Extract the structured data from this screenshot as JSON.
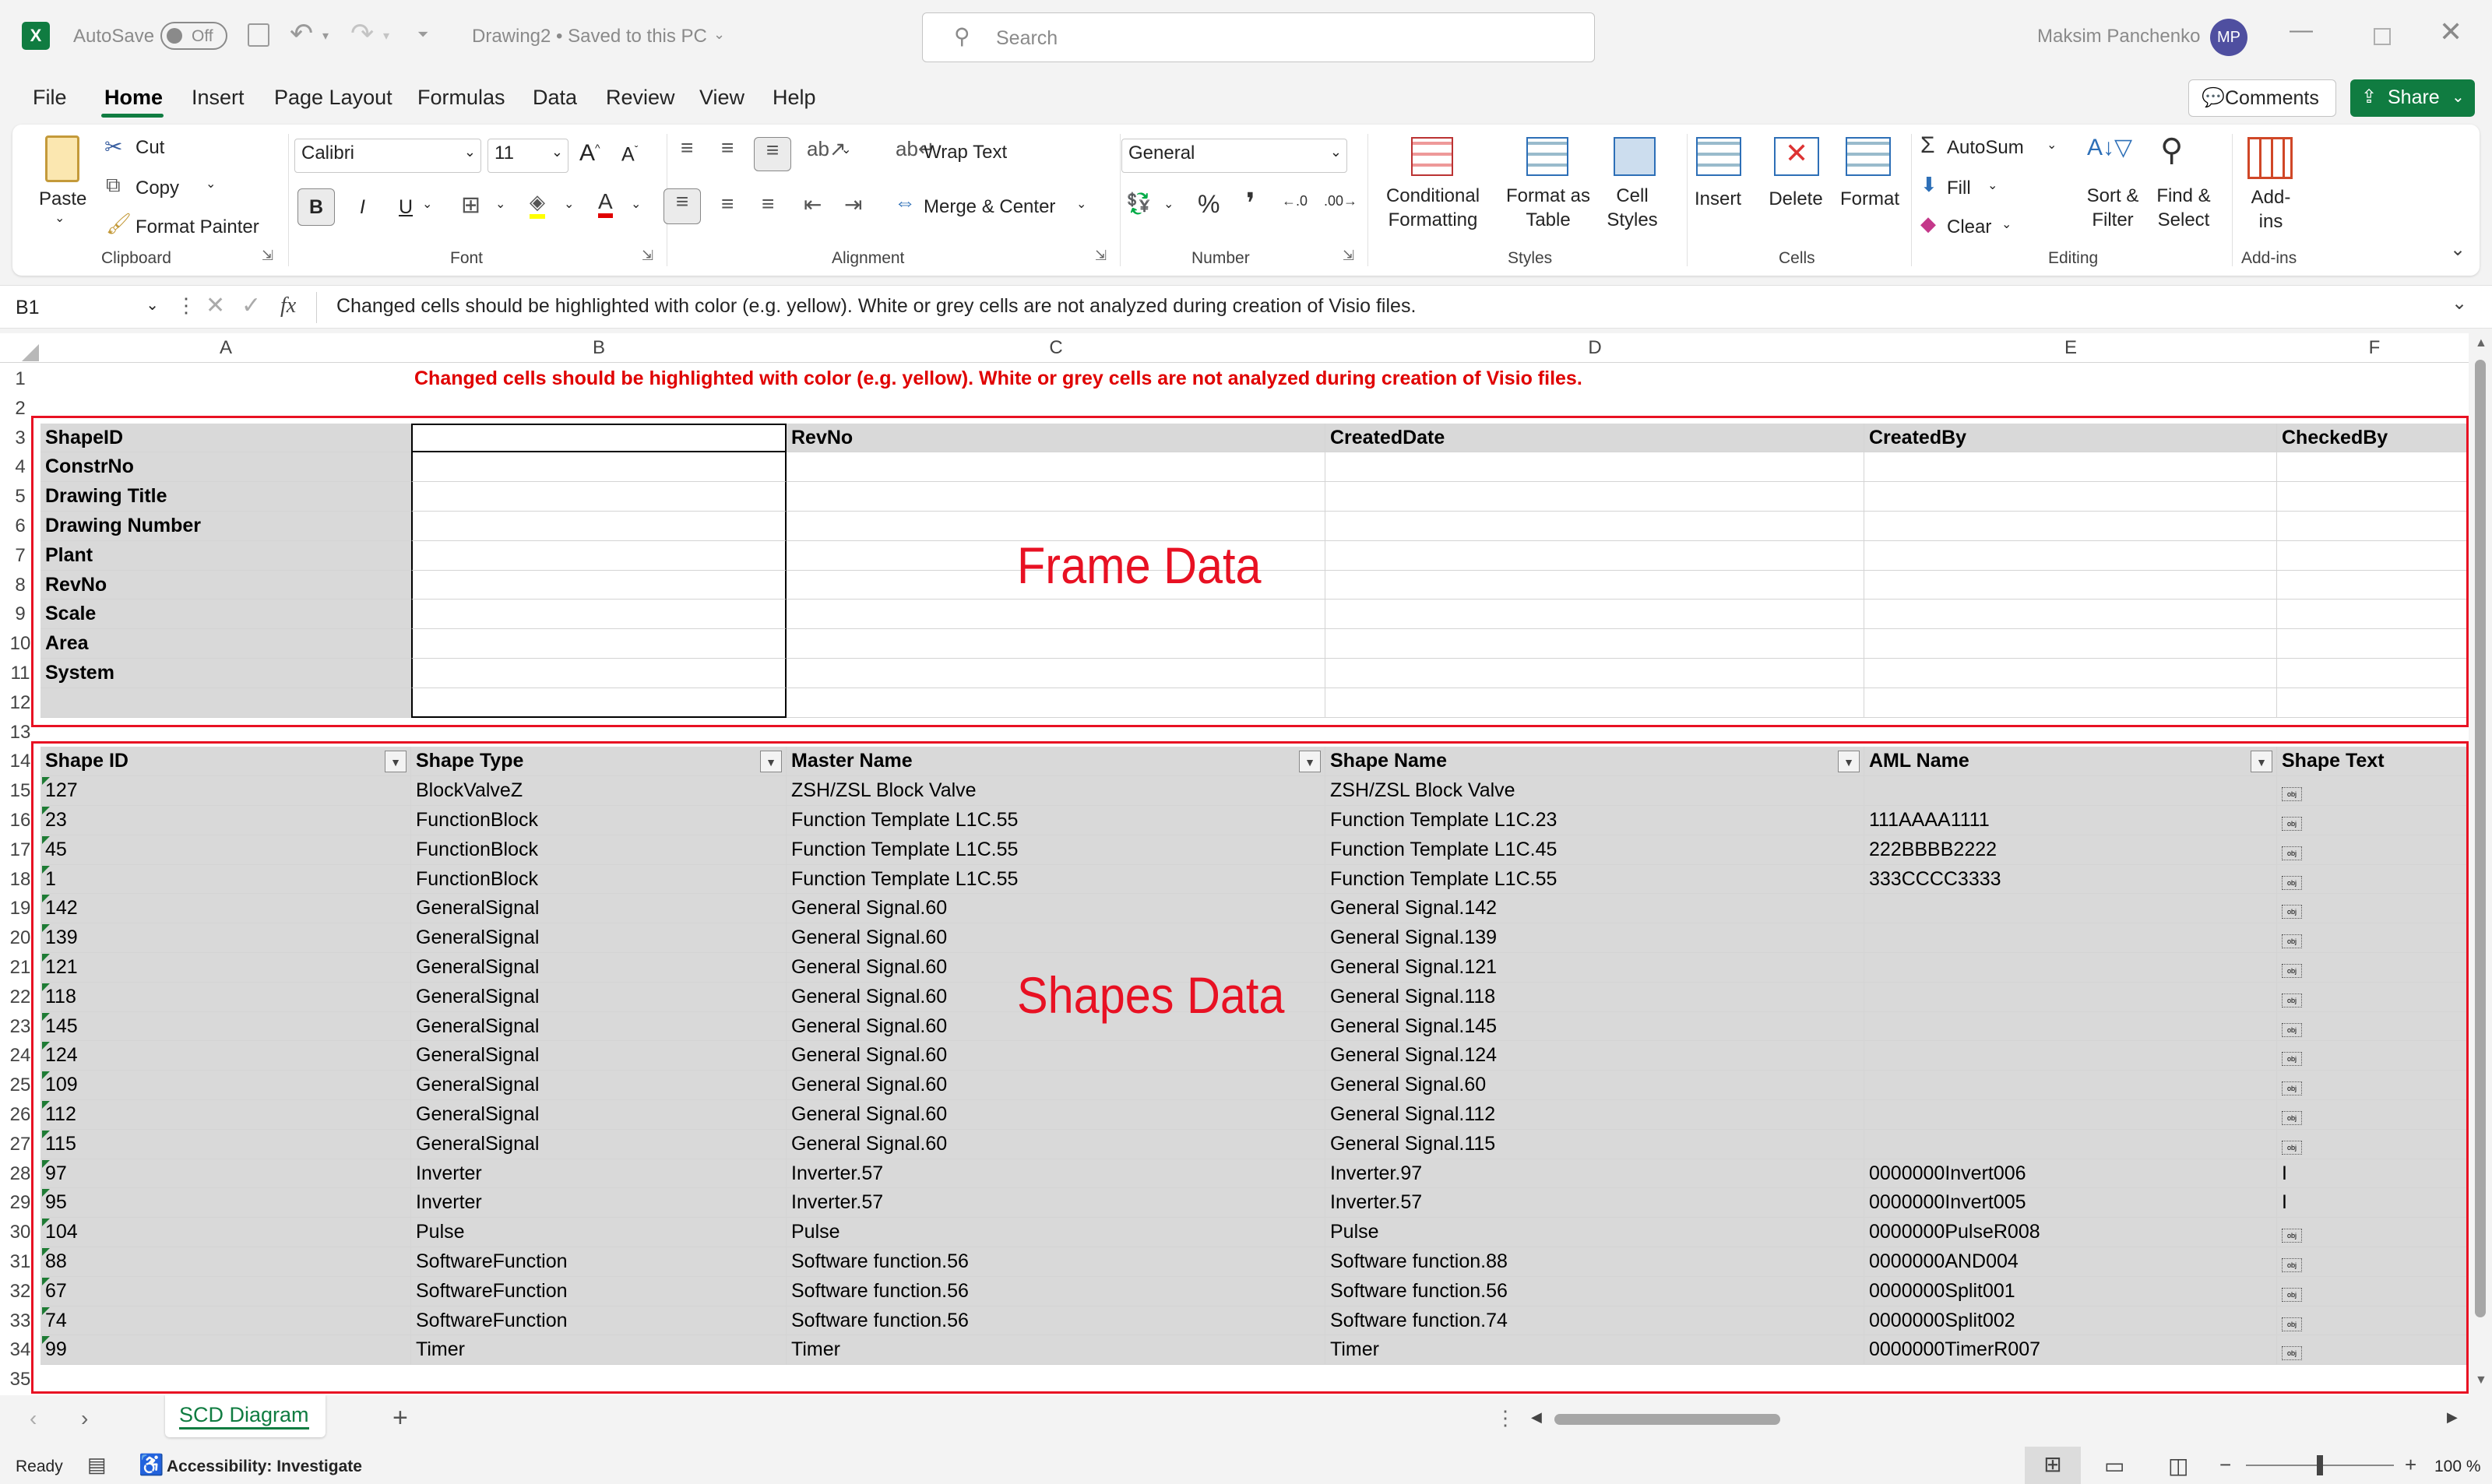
{
  "titlebar": {
    "autosave_label": "AutoSave",
    "autosave_state": "Off",
    "doc_title": "Drawing2 • Saved to this PC",
    "search_placeholder": "Search",
    "user_name": "Maksim Panchenko",
    "user_initials": "MP"
  },
  "menu": {
    "items": [
      "File",
      "Home",
      "Insert",
      "Page Layout",
      "Formulas",
      "Data",
      "Review",
      "View",
      "Help"
    ],
    "active": "Home",
    "comments": "Comments",
    "share": "Share"
  },
  "ribbon": {
    "clipboard": {
      "paste": "Paste",
      "cut": "Cut",
      "copy": "Copy",
      "format_painter": "Format Painter",
      "label": "Clipboard"
    },
    "font": {
      "name": "Calibri",
      "size": "11",
      "bold": "B",
      "italic": "I",
      "underline": "U",
      "label": "Font"
    },
    "alignment": {
      "wrap": "Wrap Text",
      "merge": "Merge & Center",
      "label": "Alignment"
    },
    "number": {
      "format": "General",
      "label": "Number"
    },
    "styles": {
      "cond": "Conditional Formatting",
      "table": "Format as Table",
      "cell": "Cell Styles",
      "label": "Styles"
    },
    "cells": {
      "insert": "Insert",
      "delete": "Delete",
      "format": "Format",
      "label": "Cells"
    },
    "editing": {
      "autosum": "AutoSum",
      "fill": "Fill",
      "clear": "Clear",
      "sort": "Sort & Filter",
      "find": "Find & Select",
      "label": "Editing"
    },
    "addins": {
      "addins": "Add-ins",
      "label": "Add-ins"
    }
  },
  "formula": {
    "name_box": "B1",
    "fx": "fx",
    "content": "Changed cells should be highlighted with color (e.g. yellow). White or grey cells are not analyzed during creation of Visio files."
  },
  "sheet": {
    "columns": [
      "A",
      "B",
      "C",
      "D",
      "E",
      "F"
    ],
    "rows": [
      "1",
      "2",
      "3",
      "4",
      "5",
      "6",
      "7",
      "8",
      "9",
      "10",
      "11",
      "12",
      "13",
      "14",
      "15",
      "16",
      "17",
      "18",
      "19",
      "20",
      "21",
      "22",
      "23",
      "24",
      "25",
      "26",
      "27",
      "28",
      "29",
      "30",
      "31",
      "32",
      "33",
      "34",
      "35"
    ],
    "notice": "Changed cells should be highlighted with color (e.g. yellow). White or grey cells are not analyzed during creation of Visio files.",
    "frame_headers": [
      "ShapeID",
      "",
      "RevNo",
      "CreatedDate",
      "CreatedBy",
      "CheckedBy"
    ],
    "frame_labels": [
      "ConstrNo",
      "Drawing Title",
      "Drawing Number",
      "Plant",
      "RevNo",
      "Scale",
      "Area",
      "System",
      ""
    ],
    "frame_annotation": "Frame Data",
    "shapes_headers": [
      "Shape ID",
      "Shape Type",
      "Master Name",
      "Shape Name",
      "AML Name",
      "Shape Text"
    ],
    "shapes_rows": [
      [
        "127",
        "BlockValveZ",
        "ZSH/ZSL Block Valve",
        "ZSH/ZSL Block Valve",
        "",
        "obj"
      ],
      [
        "23",
        "FunctionBlock",
        "Function Template L1C.55",
        "Function Template L1C.23",
        "111AAAA1111",
        "obj"
      ],
      [
        "45",
        "FunctionBlock",
        "Function Template L1C.55",
        "Function Template L1C.45",
        "222BBBB2222",
        "obj"
      ],
      [
        "1",
        "FunctionBlock",
        "Function Template L1C.55",
        "Function Template L1C.55",
        "333CCCC3333",
        "obj"
      ],
      [
        "142",
        "GeneralSignal",
        "General Signal.60",
        "General Signal.142",
        "",
        "obj"
      ],
      [
        "139",
        "GeneralSignal",
        "General Signal.60",
        "General Signal.139",
        "",
        "obj"
      ],
      [
        "121",
        "GeneralSignal",
        "General Signal.60",
        "General Signal.121",
        "",
        "obj"
      ],
      [
        "118",
        "GeneralSignal",
        "General Signal.60",
        "General Signal.118",
        "",
        "obj"
      ],
      [
        "145",
        "GeneralSignal",
        "General Signal.60",
        "General Signal.145",
        "",
        "obj"
      ],
      [
        "124",
        "GeneralSignal",
        "General Signal.60",
        "General Signal.124",
        "",
        "obj"
      ],
      [
        "109",
        "GeneralSignal",
        "General Signal.60",
        "General Signal.60",
        "",
        "obj"
      ],
      [
        "112",
        "GeneralSignal",
        "General Signal.60",
        "General Signal.112",
        "",
        "obj"
      ],
      [
        "115",
        "GeneralSignal",
        "General Signal.60",
        "General Signal.115",
        "",
        "obj"
      ],
      [
        "97",
        "Inverter",
        "Inverter.57",
        "Inverter.97",
        "0000000Invert006",
        "I"
      ],
      [
        "95",
        "Inverter",
        "Inverter.57",
        "Inverter.57",
        "0000000Invert005",
        "I"
      ],
      [
        "104",
        "Pulse",
        "Pulse",
        "Pulse",
        "0000000PulseR008",
        "obj"
      ],
      [
        "88",
        "SoftwareFunction",
        "Software function.56",
        "Software function.88",
        "0000000AND004",
        "obj"
      ],
      [
        "67",
        "SoftwareFunction",
        "Software function.56",
        "Software function.56",
        "0000000Split001",
        "obj"
      ],
      [
        "74",
        "SoftwareFunction",
        "Software function.56",
        "Software function.74",
        "0000000Split002",
        "obj"
      ],
      [
        "99",
        "Timer",
        "Timer",
        "Timer",
        "0000000TimerR007",
        "obj"
      ]
    ],
    "shapes_annotation": "Shapes Data"
  },
  "tabs": {
    "active": "SCD Diagram",
    "add": "+"
  },
  "status": {
    "ready": "Ready",
    "accessibility": "Accessibility: Investigate",
    "zoom": "100 %"
  },
  "colors": {
    "excel_green": "#107c41",
    "annotation_red": "#e81123",
    "notice_red": "#e00000",
    "gray_cell": "#d9d9d9",
    "avatar": "#4f4fa0"
  }
}
